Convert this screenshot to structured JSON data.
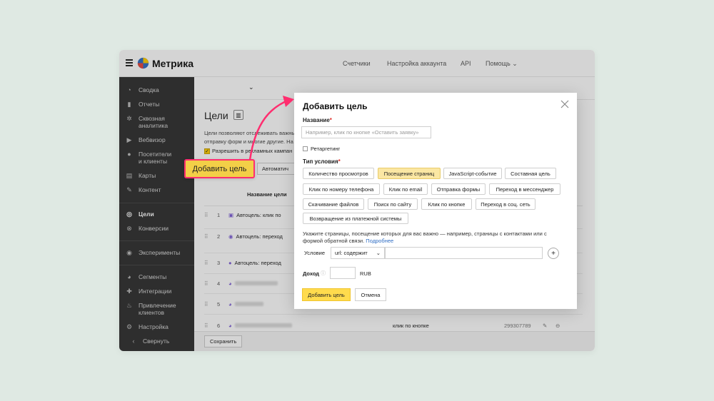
{
  "topbar": {
    "brand": "Метрика",
    "nav": [
      "Счетчики",
      "Настройка аккаунта",
      "API",
      "Помощь"
    ]
  },
  "sidebar": {
    "items": [
      {
        "label": "Сводка",
        "icon": "dashboard-icon"
      },
      {
        "label": "Отчеты",
        "icon": "bar-chart-icon"
      },
      {
        "label": "Сквозная аналитика",
        "icon": "gear-network-icon"
      },
      {
        "label": "Вебвизор",
        "icon": "play-icon"
      },
      {
        "label": "Посетители и клиенты",
        "icon": "user-icon"
      },
      {
        "label": "Карты",
        "icon": "map-icon"
      },
      {
        "label": "Контент",
        "icon": "pen-icon"
      },
      {
        "label": "Цели",
        "icon": "target-icon"
      },
      {
        "label": "Конверсии",
        "icon": "conversion-icon"
      },
      {
        "label": "Эксперименты",
        "icon": "ab-icon"
      },
      {
        "label": "Сегменты",
        "icon": "pie-icon"
      },
      {
        "label": "Интеграции",
        "icon": "puzzle-icon"
      },
      {
        "label": "Привлечение клиентов",
        "icon": "flame-icon"
      },
      {
        "label": "Настройка",
        "icon": "gear-icon"
      }
    ],
    "collapse_label": "Свернуть"
  },
  "page": {
    "title": "Цели",
    "description_1": "Цели позволяют отслеживать важны",
    "description_2": "отправку форм и многие другие. На",
    "checkbox_label": "Разрешить в рекламных кампан",
    "auto_button": "Автоматич",
    "column_header": "Название цели",
    "rows": [
      {
        "num": "1",
        "name": "Автоцель: клик по"
      },
      {
        "num": "2",
        "name": "Автоцель: переход"
      },
      {
        "num": "3",
        "name": "Автоцель: переход"
      },
      {
        "num": "4",
        "name": ""
      },
      {
        "num": "5",
        "name": ""
      },
      {
        "num": "6",
        "name": "",
        "condition": "клик по кнопке",
        "id": "299307789"
      }
    ],
    "save_button": "Сохранить"
  },
  "callout": {
    "label": "Добавить цель"
  },
  "modal": {
    "title": "Добавить цель",
    "name_label": "Название",
    "name_placeholder": "Например, клик по кнопке «Оставить заявку»",
    "retargeting_label": "Ретаргетинг",
    "condition_type_label": "Тип условия",
    "types": [
      [
        "Количество просмотров",
        "Посещение страниц",
        "JavaScript-событие",
        "Составная цель"
      ],
      [
        "Клик по номеру телефона",
        "Клик по email",
        "Отправка формы",
        "Переход в мессенджер"
      ],
      [
        "Скачивание файлов",
        "Поиск по сайту",
        "Клик по кнопке",
        "Переход в соц. сеть"
      ],
      [
        "Возвращение из платежной системы"
      ]
    ],
    "selected_type": "Посещение страниц",
    "help_text": "Укажите страницы, посещение которых для вас важно — например, страницы с контактами или с формой обратной связи.",
    "help_link": "Подробнее",
    "condition_label": "Условие",
    "condition_select": "url: содержит",
    "income_label": "Доход",
    "currency": "RUB",
    "submit_button": "Добавить цель",
    "cancel_button": "Отмена"
  },
  "colors": {
    "accent": "#ffdb4d",
    "selected_chip": "#fbe7a3",
    "callout_border": "#ff2e6f",
    "sidebar": "#303030",
    "link": "#2f6dc4"
  }
}
